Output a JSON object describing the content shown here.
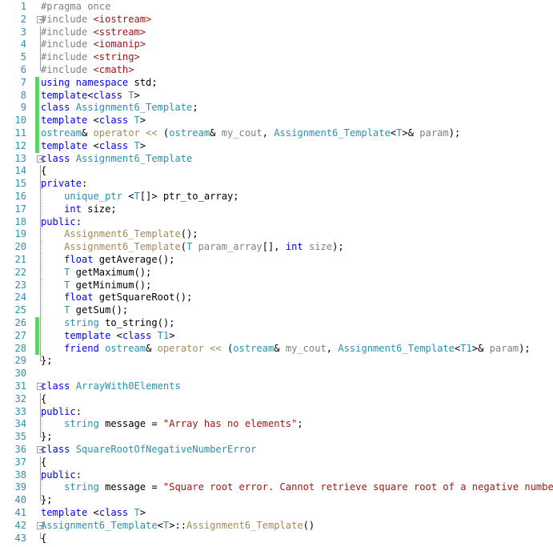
{
  "app": {
    "name": "visual-studio-code-editor",
    "language": "C++",
    "file_kind": "header"
  },
  "theme": {
    "background": "#ffffff",
    "line_number": "#2b91af",
    "change_bar_modified": "#60d26a",
    "keyword": "#0000ff",
    "user_type": "#2b91af",
    "preprocessor": "#808080",
    "string": "#a31515",
    "parameter": "#808080",
    "function": "#a08b57",
    "plain_text": "#000000",
    "fold_marker": "#a0a0a0",
    "indent_guide": "#c8c8c8"
  },
  "gutter": {
    "first_line_number": 1,
    "last_line_number": 43,
    "line_numbers": [
      1,
      2,
      3,
      4,
      5,
      6,
      7,
      8,
      9,
      10,
      11,
      12,
      13,
      14,
      15,
      16,
      17,
      18,
      19,
      20,
      21,
      22,
      23,
      24,
      25,
      26,
      27,
      28,
      29,
      30,
      31,
      32,
      33,
      34,
      35,
      36,
      37,
      38,
      39,
      40,
      41,
      42,
      43
    ],
    "change_bar_lines": [
      7,
      8,
      9,
      10,
      11,
      12,
      26,
      27,
      28
    ],
    "fold_open_lines": [
      2,
      13,
      31,
      36,
      42
    ]
  },
  "code": {
    "lines": [
      {
        "n": 1,
        "indent": 0,
        "tokens": [
          {
            "c": "pre",
            "t": "#pragma once"
          }
        ]
      },
      {
        "n": 2,
        "indent": 0,
        "tokens": [
          {
            "c": "pre",
            "t": "#include "
          },
          {
            "c": "str",
            "t": "<iostream>"
          }
        ]
      },
      {
        "n": 3,
        "indent": 0,
        "tokens": [
          {
            "c": "pre",
            "t": "#include "
          },
          {
            "c": "str",
            "t": "<sstream>"
          }
        ]
      },
      {
        "n": 4,
        "indent": 0,
        "tokens": [
          {
            "c": "pre",
            "t": "#include "
          },
          {
            "c": "str",
            "t": "<iomanip>"
          }
        ]
      },
      {
        "n": 5,
        "indent": 0,
        "tokens": [
          {
            "c": "pre",
            "t": "#include "
          },
          {
            "c": "str",
            "t": "<string>"
          }
        ]
      },
      {
        "n": 6,
        "indent": 0,
        "tokens": [
          {
            "c": "pre",
            "t": "#include "
          },
          {
            "c": "str",
            "t": "<cmath>"
          }
        ]
      },
      {
        "n": 7,
        "indent": 0,
        "tokens": [
          {
            "c": "kw",
            "t": "using namespace"
          },
          {
            "c": "plain",
            "t": " std;"
          }
        ]
      },
      {
        "n": 8,
        "indent": 0,
        "tokens": [
          {
            "c": "kw",
            "t": "template"
          },
          {
            "c": "plain",
            "t": "<"
          },
          {
            "c": "kw",
            "t": "class"
          },
          {
            "c": "plain",
            "t": " "
          },
          {
            "c": "type",
            "t": "T"
          },
          {
            "c": "plain",
            "t": ">"
          }
        ]
      },
      {
        "n": 9,
        "indent": 0,
        "tokens": [
          {
            "c": "kw",
            "t": "class"
          },
          {
            "c": "plain",
            "t": " "
          },
          {
            "c": "type",
            "t": "Assignment6_Template"
          },
          {
            "c": "plain",
            "t": ";"
          }
        ]
      },
      {
        "n": 10,
        "indent": 0,
        "tokens": [
          {
            "c": "kw",
            "t": "template"
          },
          {
            "c": "plain",
            "t": " <"
          },
          {
            "c": "kw",
            "t": "class"
          },
          {
            "c": "plain",
            "t": " "
          },
          {
            "c": "type",
            "t": "T"
          },
          {
            "c": "plain",
            "t": ">"
          }
        ]
      },
      {
        "n": 11,
        "indent": 0,
        "tokens": [
          {
            "c": "type",
            "t": "ostream"
          },
          {
            "c": "plain",
            "t": "& "
          },
          {
            "c": "func",
            "t": "operator <<"
          },
          {
            "c": "plain",
            "t": " ("
          },
          {
            "c": "type",
            "t": "ostream"
          },
          {
            "c": "plain",
            "t": "& "
          },
          {
            "c": "param",
            "t": "my_cout"
          },
          {
            "c": "plain",
            "t": ", "
          },
          {
            "c": "type",
            "t": "Assignment6_Template"
          },
          {
            "c": "plain",
            "t": "<"
          },
          {
            "c": "type",
            "t": "T"
          },
          {
            "c": "plain",
            "t": ">& "
          },
          {
            "c": "param",
            "t": "param"
          },
          {
            "c": "plain",
            "t": ");"
          }
        ]
      },
      {
        "n": 12,
        "indent": 0,
        "tokens": [
          {
            "c": "kw",
            "t": "template"
          },
          {
            "c": "plain",
            "t": " <"
          },
          {
            "c": "kw",
            "t": "class"
          },
          {
            "c": "plain",
            "t": " "
          },
          {
            "c": "type",
            "t": "T"
          },
          {
            "c": "plain",
            "t": ">"
          }
        ]
      },
      {
        "n": 13,
        "indent": 0,
        "tokens": [
          {
            "c": "kw",
            "t": "class"
          },
          {
            "c": "plain",
            "t": " "
          },
          {
            "c": "type",
            "t": "Assignment6_Template"
          }
        ]
      },
      {
        "n": 14,
        "indent": 0,
        "tokens": [
          {
            "c": "plain",
            "t": "{"
          }
        ]
      },
      {
        "n": 15,
        "indent": 0,
        "tokens": [
          {
            "c": "kw",
            "t": "private"
          },
          {
            "c": "plain",
            "t": ":"
          }
        ]
      },
      {
        "n": 16,
        "indent": 1,
        "tokens": [
          {
            "c": "plain",
            "t": "    "
          },
          {
            "c": "type",
            "t": "unique_ptr"
          },
          {
            "c": "plain",
            "t": " <"
          },
          {
            "c": "type",
            "t": "T"
          },
          {
            "c": "plain",
            "t": "[]> ptr_to_array;"
          }
        ]
      },
      {
        "n": 17,
        "indent": 1,
        "tokens": [
          {
            "c": "plain",
            "t": "    "
          },
          {
            "c": "kw",
            "t": "int"
          },
          {
            "c": "plain",
            "t": " size;"
          }
        ]
      },
      {
        "n": 18,
        "indent": 0,
        "tokens": [
          {
            "c": "kw",
            "t": "public"
          },
          {
            "c": "plain",
            "t": ":"
          }
        ]
      },
      {
        "n": 19,
        "indent": 1,
        "tokens": [
          {
            "c": "plain",
            "t": "    "
          },
          {
            "c": "func",
            "t": "Assignment6_Template"
          },
          {
            "c": "plain",
            "t": "();"
          }
        ]
      },
      {
        "n": 20,
        "indent": 1,
        "tokens": [
          {
            "c": "plain",
            "t": "    "
          },
          {
            "c": "func",
            "t": "Assignment6_Template"
          },
          {
            "c": "plain",
            "t": "("
          },
          {
            "c": "type",
            "t": "T"
          },
          {
            "c": "plain",
            "t": " "
          },
          {
            "c": "param",
            "t": "param_array"
          },
          {
            "c": "plain",
            "t": "[], "
          },
          {
            "c": "kw",
            "t": "int"
          },
          {
            "c": "plain",
            "t": " "
          },
          {
            "c": "param",
            "t": "size"
          },
          {
            "c": "plain",
            "t": ");"
          }
        ]
      },
      {
        "n": 21,
        "indent": 1,
        "tokens": [
          {
            "c": "plain",
            "t": "    "
          },
          {
            "c": "kw",
            "t": "float"
          },
          {
            "c": "plain",
            "t": " getAverage();"
          }
        ]
      },
      {
        "n": 22,
        "indent": 1,
        "tokens": [
          {
            "c": "plain",
            "t": "    "
          },
          {
            "c": "type",
            "t": "T"
          },
          {
            "c": "plain",
            "t": " getMaximum();"
          }
        ]
      },
      {
        "n": 23,
        "indent": 1,
        "tokens": [
          {
            "c": "plain",
            "t": "    "
          },
          {
            "c": "type",
            "t": "T"
          },
          {
            "c": "plain",
            "t": " getMinimum();"
          }
        ]
      },
      {
        "n": 24,
        "indent": 1,
        "tokens": [
          {
            "c": "plain",
            "t": "    "
          },
          {
            "c": "kw",
            "t": "float"
          },
          {
            "c": "plain",
            "t": " getSquareRoot();"
          }
        ]
      },
      {
        "n": 25,
        "indent": 1,
        "tokens": [
          {
            "c": "plain",
            "t": "    "
          },
          {
            "c": "type",
            "t": "T"
          },
          {
            "c": "plain",
            "t": " getSum();"
          }
        ]
      },
      {
        "n": 26,
        "indent": 1,
        "tokens": [
          {
            "c": "plain",
            "t": "    "
          },
          {
            "c": "type",
            "t": "string"
          },
          {
            "c": "plain",
            "t": " to_string();"
          }
        ]
      },
      {
        "n": 27,
        "indent": 1,
        "tokens": [
          {
            "c": "plain",
            "t": "    "
          },
          {
            "c": "kw",
            "t": "template"
          },
          {
            "c": "plain",
            "t": " <"
          },
          {
            "c": "kw",
            "t": "class"
          },
          {
            "c": "plain",
            "t": " "
          },
          {
            "c": "type",
            "t": "T1"
          },
          {
            "c": "plain",
            "t": ">"
          }
        ]
      },
      {
        "n": 28,
        "indent": 1,
        "tokens": [
          {
            "c": "plain",
            "t": "    "
          },
          {
            "c": "kw",
            "t": "friend"
          },
          {
            "c": "plain",
            "t": " "
          },
          {
            "c": "type",
            "t": "ostream"
          },
          {
            "c": "plain",
            "t": "& "
          },
          {
            "c": "func",
            "t": "operator <<"
          },
          {
            "c": "plain",
            "t": " ("
          },
          {
            "c": "type",
            "t": "ostream"
          },
          {
            "c": "plain",
            "t": "& "
          },
          {
            "c": "param",
            "t": "my_cout"
          },
          {
            "c": "plain",
            "t": ", "
          },
          {
            "c": "type",
            "t": "Assignment6_Template"
          },
          {
            "c": "plain",
            "t": "<"
          },
          {
            "c": "type",
            "t": "T1"
          },
          {
            "c": "plain",
            "t": ">& "
          },
          {
            "c": "param",
            "t": "param"
          },
          {
            "c": "plain",
            "t": ");"
          }
        ]
      },
      {
        "n": 29,
        "indent": 0,
        "tokens": [
          {
            "c": "plain",
            "t": "};"
          }
        ]
      },
      {
        "n": 30,
        "indent": 0,
        "tokens": [
          {
            "c": "plain",
            "t": ""
          }
        ]
      },
      {
        "n": 31,
        "indent": 0,
        "tokens": [
          {
            "c": "kw",
            "t": "class"
          },
          {
            "c": "plain",
            "t": " "
          },
          {
            "c": "type",
            "t": "ArrayWith0Elements"
          }
        ]
      },
      {
        "n": 32,
        "indent": 0,
        "tokens": [
          {
            "c": "plain",
            "t": "{"
          }
        ]
      },
      {
        "n": 33,
        "indent": 0,
        "tokens": [
          {
            "c": "kw",
            "t": "public"
          },
          {
            "c": "plain",
            "t": ":"
          }
        ]
      },
      {
        "n": 34,
        "indent": 1,
        "tokens": [
          {
            "c": "plain",
            "t": "    "
          },
          {
            "c": "type",
            "t": "string"
          },
          {
            "c": "plain",
            "t": " message = "
          },
          {
            "c": "str",
            "t": "\"Array has no elements\""
          },
          {
            "c": "plain",
            "t": ";"
          }
        ]
      },
      {
        "n": 35,
        "indent": 0,
        "tokens": [
          {
            "c": "plain",
            "t": "};"
          }
        ]
      },
      {
        "n": 36,
        "indent": 0,
        "tokens": [
          {
            "c": "kw",
            "t": "class"
          },
          {
            "c": "plain",
            "t": " "
          },
          {
            "c": "type",
            "t": "SquareRootOfNegativeNumberError"
          }
        ]
      },
      {
        "n": 37,
        "indent": 0,
        "tokens": [
          {
            "c": "plain",
            "t": "{"
          }
        ]
      },
      {
        "n": 38,
        "indent": 0,
        "tokens": [
          {
            "c": "kw",
            "t": "public"
          },
          {
            "c": "plain",
            "t": ":"
          }
        ]
      },
      {
        "n": 39,
        "indent": 1,
        "tokens": [
          {
            "c": "plain",
            "t": "    "
          },
          {
            "c": "type",
            "t": "string"
          },
          {
            "c": "plain",
            "t": " message = "
          },
          {
            "c": "str",
            "t": "\"Square root error. Cannot retrieve square root of a negative number\""
          },
          {
            "c": "plain",
            "t": ";"
          }
        ]
      },
      {
        "n": 40,
        "indent": 0,
        "tokens": [
          {
            "c": "plain",
            "t": "};"
          }
        ]
      },
      {
        "n": 41,
        "indent": 0,
        "tokens": [
          {
            "c": "kw",
            "t": "template"
          },
          {
            "c": "plain",
            "t": " <"
          },
          {
            "c": "kw",
            "t": "class"
          },
          {
            "c": "plain",
            "t": " "
          },
          {
            "c": "type",
            "t": "T"
          },
          {
            "c": "plain",
            "t": ">"
          }
        ]
      },
      {
        "n": 42,
        "indent": 0,
        "tokens": [
          {
            "c": "type",
            "t": "Assignment6_Template"
          },
          {
            "c": "plain",
            "t": "<"
          },
          {
            "c": "type",
            "t": "T"
          },
          {
            "c": "plain",
            "t": ">::"
          },
          {
            "c": "func",
            "t": "Assignment6_Template"
          },
          {
            "c": "plain",
            "t": "()"
          }
        ]
      },
      {
        "n": 43,
        "indent": 0,
        "tokens": [
          {
            "c": "plain",
            "t": "{"
          }
        ]
      }
    ]
  }
}
